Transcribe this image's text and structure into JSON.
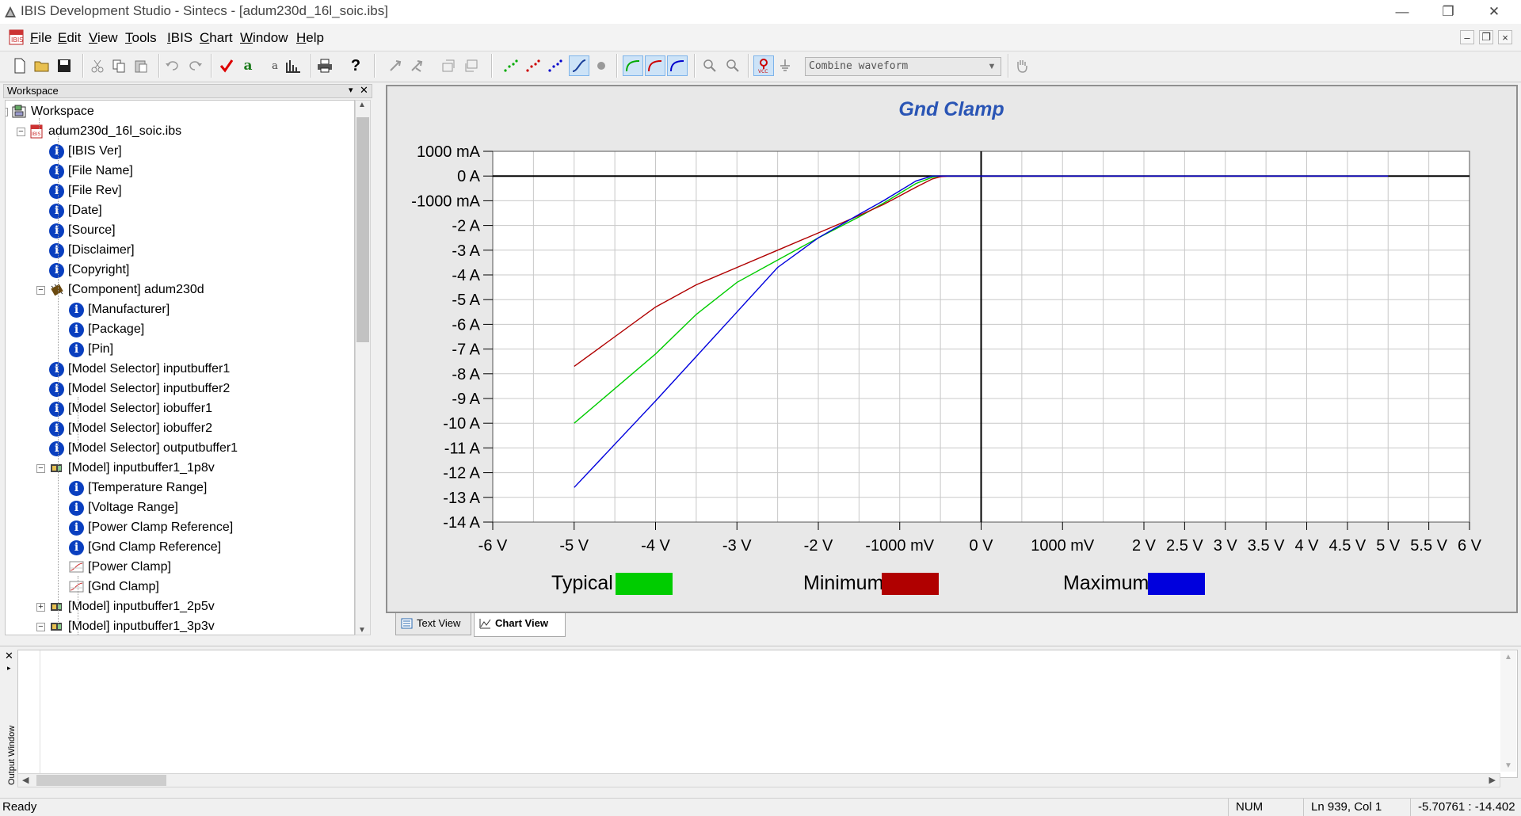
{
  "window": {
    "title": "IBIS Development Studio - Sintecs - [adum230d_16l_soic.ibs]"
  },
  "menu": [
    "File",
    "Edit",
    "View",
    "Tools",
    "IBIS",
    "Chart",
    "Window",
    "Help"
  ],
  "toolbar": {
    "combine_waveform": "Combine waveform"
  },
  "workspace": {
    "header": "Workspace",
    "tree": [
      {
        "label": "Workspace",
        "level": 0,
        "icon": "workspace"
      },
      {
        "label": "adum230d_16l_soic.ibs",
        "level": 1,
        "icon": "ibs-file"
      },
      {
        "label": "[IBIS Ver]",
        "level": 2,
        "icon": "info"
      },
      {
        "label": "[File Name]",
        "level": 2,
        "icon": "info"
      },
      {
        "label": "[File Rev]",
        "level": 2,
        "icon": "info"
      },
      {
        "label": "[Date]",
        "level": 2,
        "icon": "info"
      },
      {
        "label": "[Source]",
        "level": 2,
        "icon": "info"
      },
      {
        "label": "[Disclaimer]",
        "level": 2,
        "icon": "info"
      },
      {
        "label": "[Copyright]",
        "level": 2,
        "icon": "info"
      },
      {
        "label": "[Component] adum230d",
        "level": 2,
        "icon": "component"
      },
      {
        "label": "[Manufacturer]",
        "level": 3,
        "icon": "info"
      },
      {
        "label": "[Package]",
        "level": 3,
        "icon": "info"
      },
      {
        "label": "[Pin]",
        "level": 3,
        "icon": "info"
      },
      {
        "label": "[Model Selector] inputbuffer1",
        "level": 2,
        "icon": "info"
      },
      {
        "label": "[Model Selector] inputbuffer2",
        "level": 2,
        "icon": "info"
      },
      {
        "label": "[Model Selector] iobuffer1",
        "level": 2,
        "icon": "info"
      },
      {
        "label": "[Model Selector] iobuffer2",
        "level": 2,
        "icon": "info"
      },
      {
        "label": "[Model Selector] outputbuffer1",
        "level": 2,
        "icon": "info"
      },
      {
        "label": "[Model] inputbuffer1_1p8v",
        "level": 2,
        "icon": "model"
      },
      {
        "label": "[Temperature Range]",
        "level": 3,
        "icon": "info"
      },
      {
        "label": "[Voltage Range]",
        "level": 3,
        "icon": "info"
      },
      {
        "label": "[Power Clamp Reference]",
        "level": 3,
        "icon": "info"
      },
      {
        "label": "[Gnd Clamp Reference]",
        "level": 3,
        "icon": "info"
      },
      {
        "label": "[Power Clamp]",
        "level": 3,
        "icon": "chart"
      },
      {
        "label": "[Gnd Clamp]",
        "level": 3,
        "icon": "chart"
      },
      {
        "label": "[Model] inputbuffer1_2p5v",
        "level": 2,
        "icon": "model"
      },
      {
        "label": "[Model] inputbuffer1_3p3v",
        "level": 2,
        "icon": "model"
      }
    ]
  },
  "chart_data": {
    "type": "line",
    "title": "Gnd Clamp",
    "x_tick_labels": [
      "-6 V",
      "-5 V",
      "-4 V",
      "-3 V",
      "-2 V",
      "-1000 mV",
      "0 V",
      "1000 mV",
      "2 V",
      "2.5 V",
      "3 V",
      "3.5 V",
      "4 V",
      "4.5 V",
      "5 V",
      "5.5 V",
      "6 V"
    ],
    "y_tick_labels": [
      "1000 mA",
      "0 A",
      "-1000 mA",
      "-2  A",
      "-3  A",
      "-4  A",
      "-5  A",
      "-6  A",
      "-7  A",
      "-8  A",
      "-9  A",
      "-10  A",
      "-11  A",
      "-12  A",
      "-13  A",
      "-14  A"
    ],
    "xlim": [
      -6,
      6
    ],
    "ylim": [
      -14,
      1
    ],
    "grid": true,
    "legend_position": "bottom",
    "series": [
      {
        "name": "Typical",
        "color": "#00cc00",
        "x": [
          -5,
          -4,
          -3.5,
          -3,
          -2.5,
          -2,
          -1.5,
          -1.2,
          -1,
          -0.8,
          -0.6,
          -0.5,
          -0.4,
          0,
          5
        ],
        "y": [
          -10,
          -7.2,
          -5.6,
          -4.3,
          -3.4,
          -2.5,
          -1.65,
          -1.1,
          -0.7,
          -0.3,
          -0.05,
          0,
          0,
          0,
          0
        ]
      },
      {
        "name": "Minimum",
        "color": "#b00000",
        "x": [
          -5,
          -4,
          -3.5,
          -3,
          -2.5,
          -2,
          -1.5,
          -1.2,
          -1,
          -0.8,
          -0.6,
          -0.5,
          -0.4,
          0,
          5
        ],
        "y": [
          -7.7,
          -5.3,
          -4.4,
          -3.7,
          -3.0,
          -2.3,
          -1.6,
          -1.15,
          -0.8,
          -0.45,
          -0.12,
          -0.03,
          0,
          0,
          0
        ]
      },
      {
        "name": "Maximum",
        "color": "#0000dd",
        "x": [
          -5,
          -4,
          -3.5,
          -3,
          -2.5,
          -2,
          -1.5,
          -1.2,
          -1,
          -0.8,
          -0.6,
          -0.5,
          -0.4,
          0,
          5
        ],
        "y": [
          -12.6,
          -9.1,
          -7.3,
          -5.5,
          -3.7,
          -2.5,
          -1.55,
          -1.0,
          -0.6,
          -0.2,
          0,
          0,
          0,
          0,
          0
        ]
      }
    ]
  },
  "tabs": [
    "Text View",
    "Chart View"
  ],
  "output": {
    "label": "Output Window"
  },
  "status": {
    "ready": "Ready",
    "num": "NUM",
    "position": "Ln 939, Col 1",
    "coords": "-5.70761 : -14.402"
  }
}
